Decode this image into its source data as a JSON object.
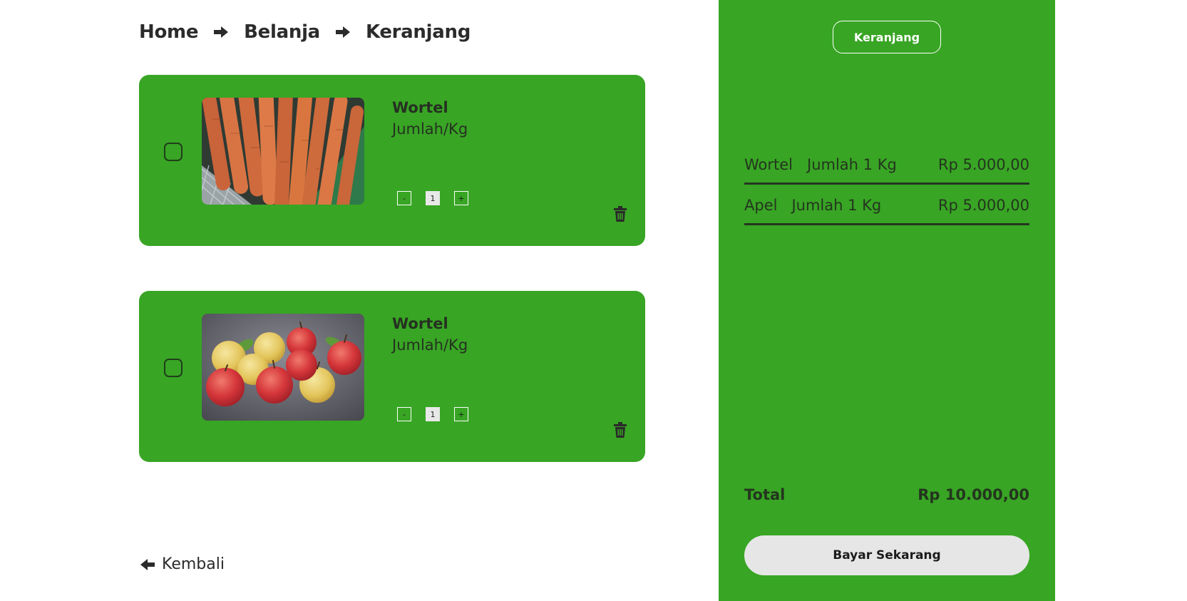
{
  "breadcrumb": {
    "items": [
      "Home",
      "Belanja",
      "Keranjang"
    ]
  },
  "cart_items": [
    {
      "name": "Wortel",
      "unit": "Jumlah/Kg",
      "quantity": "1",
      "minus": "-",
      "plus": "+"
    },
    {
      "name": "Wortel",
      "unit": "Jumlah/Kg",
      "quantity": "1",
      "minus": "-",
      "plus": "+"
    }
  ],
  "back": {
    "label": "Kembali"
  },
  "sidebar": {
    "tab_label": "Keranjang",
    "summary": [
      {
        "name": "Wortel",
        "qty": "Jumlah 1 Kg",
        "price": "Rp 5.000,00"
      },
      {
        "name": "Apel",
        "qty": "Jumlah 1 Kg",
        "price": "Rp 5.000,00"
      }
    ],
    "total_label": "Total",
    "total_value": "Rp 10.000,00",
    "pay_label": "Bayar Sekarang"
  },
  "colors": {
    "accent": "#38a524",
    "pay_button": "#e6e6e6",
    "text_dark": "#263022"
  },
  "icons": [
    "arrow-right-icon",
    "arrow-left-icon",
    "trash-icon"
  ]
}
